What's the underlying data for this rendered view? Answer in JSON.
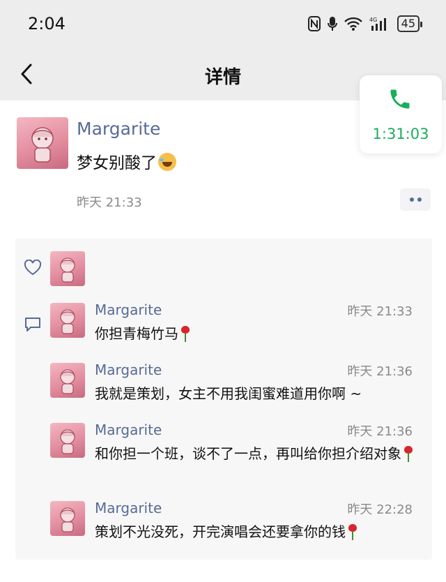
{
  "status_bar": {
    "time": "2:04",
    "battery": "45"
  },
  "nav": {
    "title": "详情"
  },
  "call": {
    "duration": "1:31:03",
    "accent": "#1aad5c"
  },
  "post": {
    "author": "Margarite",
    "content": "梦女别酸了",
    "date": "昨天 21:33"
  },
  "comments": [
    {
      "name": "Margarite",
      "time": "昨天 21:33",
      "text": "你担青梅竹马"
    },
    {
      "name": "Margarite",
      "time": "昨天 21:36",
      "text": "我就是策划，女主不用我闺蜜难道用你啊 ~"
    },
    {
      "name": "Margarite",
      "time": "昨天 21:36",
      "text": "和你担一个班，谈不了一点，再叫给你担介绍对象"
    },
    {
      "name": "Margarite",
      "time": "昨天 22:28",
      "text": "策划不光没死，开完演唱会还要拿你的钱"
    }
  ],
  "colors": {
    "name_link": "#576b95",
    "meta": "#8a8a8a",
    "header_bg": "#ededed",
    "panel_bg": "#f7f7f7"
  }
}
